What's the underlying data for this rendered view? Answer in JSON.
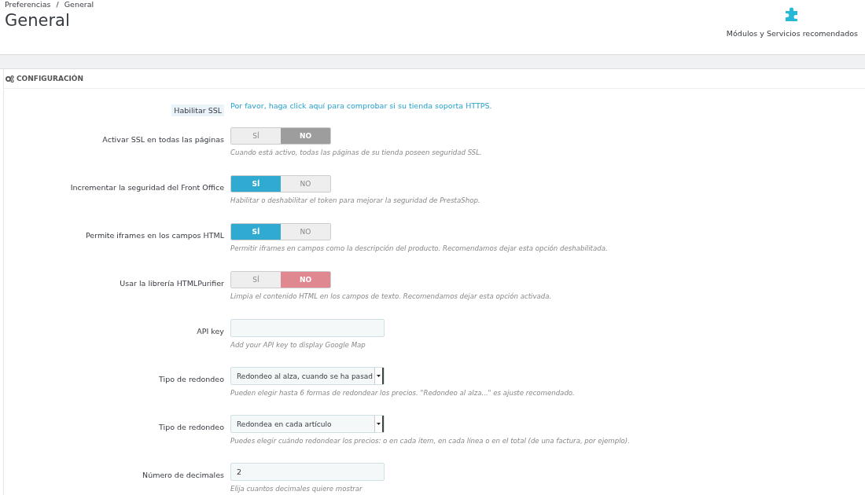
{
  "breadcrumb": [
    "Preferencias",
    "General"
  ],
  "breadcrumb_separator": "/",
  "title": "General",
  "toolbar": {
    "button": "Módulos y Servicios recomendados"
  },
  "panel": {
    "heading": "CONFIGURACIÓN"
  },
  "rows": [
    {
      "kind": "link",
      "label": "Habilitar SSL",
      "link": "Por favor, haga click aquí para comprobar si su tienda soporta HTTPS."
    },
    {
      "kind": "toggle",
      "label": "Activar SSL en todas las páginas",
      "disabled": true,
      "options": [
        {
          "label": "SÍ",
          "selected": false
        },
        {
          "label": "NO",
          "selected": true
        }
      ],
      "help": "Cuando está activo, todas las páginas de su tienda poseen seguridad SSL."
    },
    {
      "kind": "toggle",
      "label": "Incrementar la seguridad del Front Office",
      "disabled": false,
      "options": [
        {
          "label": "SÍ",
          "selected": true
        },
        {
          "label": "NO",
          "selected": false
        }
      ],
      "help": "Habilitar o deshabilitar el token para mejorar la seguridad de PrestaShop."
    },
    {
      "kind": "toggle",
      "label": "Permite iframes en los campos HTML",
      "disabled": false,
      "options": [
        {
          "label": "SÍ",
          "selected": true
        },
        {
          "label": "NO",
          "selected": false
        }
      ],
      "help": "Permitir iframes en campos como la descripción del producto. Recomendamos dejar esta opción deshabilitada."
    },
    {
      "kind": "toggle",
      "label": "Usar la librería HTMLPurifier",
      "disabled": false,
      "options": [
        {
          "label": "SÍ",
          "selected": false
        },
        {
          "label": "NO",
          "selected": true
        }
      ],
      "help": "Limpia el contenido HTML en los campos de texto. Recomendamos dejar esta opción activada."
    },
    {
      "kind": "text",
      "label": "API key",
      "help": "Add your API key to display Google Map"
    },
    {
      "kind": "select",
      "label": "Tipo de redondeo",
      "value": "Redondeo al alza, cuando se ha pasad",
      "help": "Pueden elegir hasta 6 formas de redondear los precios. \"Redondeo al alza...\" es ajuste recomendado."
    },
    {
      "kind": "select",
      "label": "Tipo de redondeo",
      "value": "Redondea en cada artículo",
      "help": "Puedes elegir cuándo redondear los precios: o en cada item, en cada línea o en el total (de una factura, por ejemplo)."
    },
    {
      "kind": "text",
      "label": "Número de decimales",
      "value": "2",
      "help": "Elija cuantos decimales quiere mostrar"
    }
  ]
}
